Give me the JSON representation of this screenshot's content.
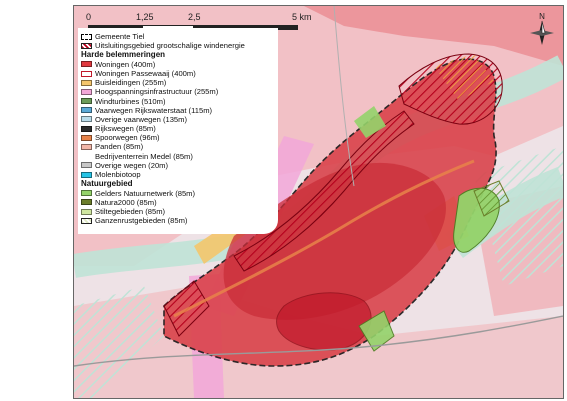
{
  "map": {
    "scalebar": {
      "ticks": [
        "0",
        "1,25",
        "2,5",
        "5 km"
      ]
    },
    "north_label": "N",
    "legend": {
      "items_top": [
        {
          "label": "Gemeente Tiel",
          "icon": "municipality-boundary-icon",
          "color": "#000000",
          "style": "dashed-outline"
        },
        {
          "label": "Uitsluitingsgebied grootschalige windenergie",
          "icon": "exclusion-area-icon",
          "color": "#b5001c",
          "style": "hatched-outline"
        }
      ],
      "section_hard": "Harde belemmeringen",
      "items_hard": [
        {
          "label": "Woningen (400m)",
          "icon": "dwellings-icon",
          "color": "#e0383e",
          "style": "fill"
        },
        {
          "label": "Woningen Passewaaij (400m)",
          "icon": "dwellings-passewaaij-icon",
          "color": "#c0182a",
          "style": "outline"
        },
        {
          "label": "Buisleidingen (255m)",
          "icon": "pipelines-icon",
          "color": "#f4c56c",
          "style": "fill"
        },
        {
          "label": "Hoogspanningsinfrastructuur (255m)",
          "icon": "high-voltage-icon",
          "color": "#f2a7d8",
          "style": "fill"
        },
        {
          "label": "Windturbines (510m)",
          "icon": "wind-turbines-icon",
          "color": "#6a9b58",
          "style": "fill"
        },
        {
          "label": "Vaarwegen Rijkswaterstaat (115m)",
          "icon": "waterways-icon",
          "color": "#5aa9d6",
          "style": "fill"
        },
        {
          "label": "Overige vaarwegen (135m)",
          "icon": "other-waterways-icon",
          "color": "#b9dcea",
          "style": "fill"
        },
        {
          "label": "Rijkswegen (85m)",
          "icon": "national-roads-icon",
          "color": "#2b2b2b",
          "style": "fill"
        },
        {
          "label": "Spoorwegen (96m)",
          "icon": "railways-icon",
          "color": "#e8834a",
          "style": "fill"
        },
        {
          "label": "Panden (85m)",
          "icon": "buildings-icon",
          "color": "#f2b6a8",
          "style": "fill"
        },
        {
          "label": "Bedrijventerrein Medel (85m)",
          "icon": "industrial-estate-icon",
          "color": "#ffffff",
          "style": "outline"
        },
        {
          "label": "Overige wegen (20m)",
          "icon": "other-roads-icon",
          "color": "#c8c8c8",
          "style": "fill"
        },
        {
          "label": "Molenbiotoop",
          "icon": "mill-biotope-icon",
          "color": "#27c4e6",
          "style": "fill"
        }
      ],
      "section_nature": "Natuurgebied",
      "items_nature": [
        {
          "label": "Gelders Natuurnetwerk (85m)",
          "icon": "nature-network-icon",
          "color": "#94d36a",
          "style": "fill"
        },
        {
          "label": "Natura2000 (85m)",
          "icon": "natura2000-icon",
          "color": "#6b7d2a",
          "style": "fill"
        },
        {
          "label": "Stiltegebieden (85m)",
          "icon": "quiet-areas-icon",
          "color": "#cfe6a0",
          "style": "fill"
        },
        {
          "label": "Ganzenrustgebieden (85m)",
          "icon": "goose-rest-areas-icon",
          "color": "#e0eac4",
          "style": "hatched-outline"
        }
      ]
    }
  }
}
